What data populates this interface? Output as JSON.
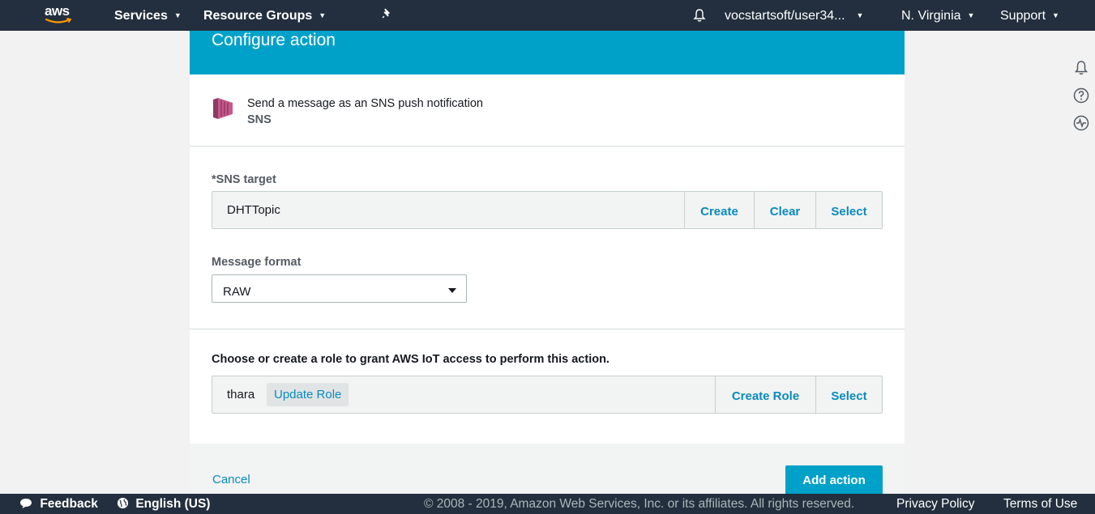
{
  "topnav": {
    "logo_text": "aws",
    "services_label": "Services",
    "resource_groups_label": "Resource Groups",
    "pin_icon": "pin-icon",
    "bell_icon": "bell-icon",
    "account_label": "vocstartsoft/user34...",
    "region_label": "N. Virginia",
    "support_label": "Support"
  },
  "right_rail": {
    "icons": [
      "bell-icon",
      "help-icon",
      "activity-icon"
    ]
  },
  "card": {
    "title": "Configure action",
    "action": {
      "description": "Send a message as an SNS push notification",
      "service": "SNS",
      "icon": "sns-icon"
    },
    "sns_target": {
      "label": "*SNS target",
      "value": "DHTTopic",
      "create_label": "Create",
      "clear_label": "Clear",
      "select_label": "Select"
    },
    "message_format": {
      "label": "Message format",
      "selected": "RAW"
    },
    "role": {
      "label": "Choose or create a role to grant AWS IoT access to perform this action.",
      "value": "thara",
      "update_label": "Update Role",
      "create_label": "Create Role",
      "select_label": "Select"
    },
    "cancel_label": "Cancel",
    "add_action_label": "Add action"
  },
  "bottombar": {
    "feedback_label": "Feedback",
    "language_label": "English (US)",
    "copyright": "© 2008 - 2019, Amazon Web Services, Inc. or its affiliates. All rights reserved.",
    "privacy_label": "Privacy Policy",
    "terms_label": "Terms of Use"
  },
  "colors": {
    "nav_bg": "#232f3e",
    "accent": "#00a1c9",
    "link": "#0a8bbd",
    "sns_icon": "#c7578c"
  }
}
